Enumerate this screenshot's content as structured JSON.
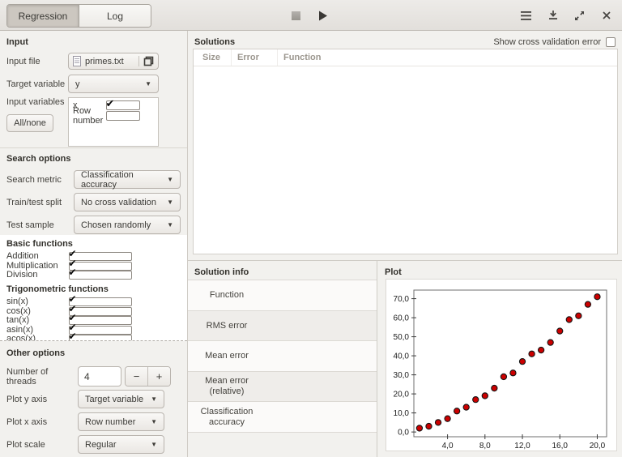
{
  "tabs": [
    {
      "label": "Regression",
      "active": true
    },
    {
      "label": "Log",
      "active": false
    }
  ],
  "toolbar": {
    "icons": [
      "stop-icon",
      "play-icon",
      "menu-icon",
      "download-icon",
      "expand-icon",
      "close-icon"
    ]
  },
  "input_section": {
    "title": "Input",
    "input_file": {
      "label": "Input file",
      "value": "primes.txt"
    },
    "target_variable": {
      "label": "Target variable",
      "value": "y"
    },
    "input_variables": {
      "label": "Input variables",
      "all_none_label": "All/none",
      "items": [
        {
          "name": "x",
          "checked": true
        },
        {
          "name": "Row number",
          "checked": false
        }
      ]
    }
  },
  "search_options": {
    "title": "Search options",
    "search_metric": {
      "label": "Search metric",
      "value": "Classification accuracy"
    },
    "train_test_split": {
      "label": "Train/test split",
      "value": "No cross validation"
    },
    "test_sample": {
      "label": "Test sample",
      "value": "Chosen randomly"
    }
  },
  "functions": {
    "groups": [
      {
        "title": "Basic functions",
        "items": [
          {
            "name": "Addition",
            "checked": true
          },
          {
            "name": "Multiplication",
            "checked": true
          },
          {
            "name": "Division",
            "checked": true
          }
        ]
      },
      {
        "title": "Trigonometric functions",
        "items": [
          {
            "name": "sin(x)",
            "checked": true
          },
          {
            "name": "cos(x)",
            "checked": true
          },
          {
            "name": "tan(x)",
            "checked": true
          },
          {
            "name": "asin(x)",
            "checked": true
          },
          {
            "name": "acos(x)",
            "checked": true
          }
        ]
      }
    ]
  },
  "other_options": {
    "title": "Other options",
    "threads": {
      "label": "Number of threads",
      "value": "4",
      "minus": "−",
      "plus": "+"
    },
    "plot_y_axis": {
      "label": "Plot y axis",
      "value": "Target variable"
    },
    "plot_x_axis": {
      "label": "Plot x axis",
      "value": "Row number"
    },
    "plot_scale": {
      "label": "Plot scale",
      "value": "Regular"
    }
  },
  "solutions": {
    "title": "Solutions",
    "show_cv_label": "Show cross validation error",
    "show_cv_checked": false,
    "columns": [
      "Size",
      "Error",
      "Function"
    ],
    "rows": []
  },
  "solution_info": {
    "title": "Solution info",
    "rows": [
      [
        "Function",
        ""
      ],
      [
        "RMS error",
        ""
      ],
      [
        "Mean error",
        ""
      ],
      [
        "Mean error",
        "(relative)"
      ],
      [
        "Classification",
        "accuracy"
      ]
    ]
  },
  "plot_panel": {
    "title": "Plot"
  },
  "chart_data": {
    "type": "scatter",
    "title": "",
    "xlabel": "",
    "ylabel": "",
    "x": [
      1,
      2,
      3,
      4,
      5,
      6,
      7,
      8,
      9,
      10,
      11,
      12,
      13,
      14,
      15,
      16,
      17,
      18,
      19,
      20
    ],
    "y": [
      2,
      3,
      5,
      7,
      11,
      13,
      17,
      19,
      23,
      29,
      31,
      37,
      41,
      43,
      47,
      53,
      59,
      61,
      67,
      71
    ],
    "xlim": [
      0.4,
      21.0
    ],
    "ylim": [
      -2.5,
      74.5
    ],
    "x_ticks": [
      {
        "v": 4,
        "label": "4,0"
      },
      {
        "v": 8,
        "label": "8,0"
      },
      {
        "v": 12,
        "label": "12,0"
      },
      {
        "v": 16,
        "label": "16,0"
      },
      {
        "v": 20,
        "label": "20,0"
      }
    ],
    "y_ticks": [
      {
        "v": 0,
        "label": "0,0"
      },
      {
        "v": 10,
        "label": "10,0"
      },
      {
        "v": 20,
        "label": "20,0"
      },
      {
        "v": 30,
        "label": "30,0"
      },
      {
        "v": 40,
        "label": "40,0"
      },
      {
        "v": 50,
        "label": "50,0"
      },
      {
        "v": 60,
        "label": "60,0"
      },
      {
        "v": 70,
        "label": "70,0"
      }
    ],
    "grid": false,
    "legend": null,
    "point_color": "#cc0000",
    "point_edge": "#141414"
  }
}
